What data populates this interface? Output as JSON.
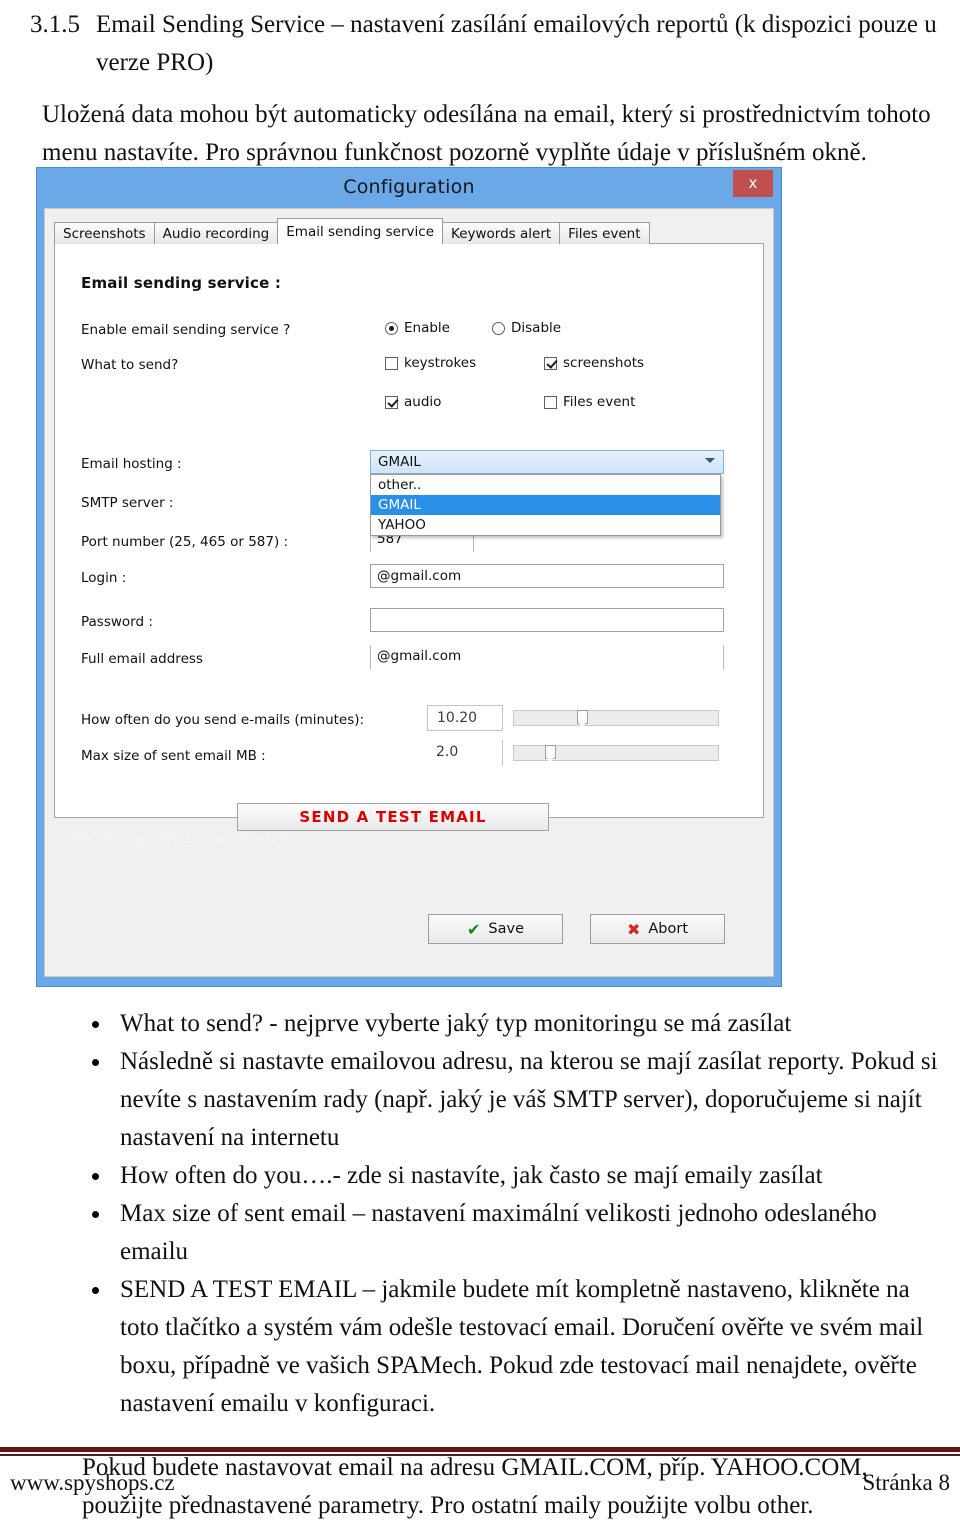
{
  "document": {
    "heading_number": "3.1.5",
    "heading_text": "Email Sending Service – nastavení zasílání emailových reportů (k dispozici pouze u verze PRO)",
    "intro_paragraph": "Uložená data mohou být automaticky odesílána na email, který si prostřednictvím tohoto menu nastavíte. Pro správnou funkčnost pozorně vyplňte údaje v příslušném okně.",
    "bullets": [
      "What to send? - nejprve vyberte jaký typ monitoringu se má zasílat",
      "Následně si nastavte emailovou adresu, na kterou se mají zasílat reporty. Pokud si nevíte s nastavením rady (např. jaký je váš SMTP server), doporučujeme si najít nastavení na internetu",
      "How often do you….- zde si nastavíte, jak často se mají emaily zasílat",
      "Max size of sent email – nastavení maximální velikosti jednoho odeslaného emailu",
      "SEND A TEST EMAIL – jakmile budete mít kompletně nastaveno, klikněte na toto tlačítko a systém vám odešle testovací email. Doručení ověřte ve svém mail boxu, případně ve vašich SPAMech. Pokud zde testovací mail nenajdete, ověřte nastavení emailu v konfiguraci."
    ],
    "closing_paragraph": "Pokud budete nastavovat email na adresu GMAIL.COM, příp. YAHOO.COM, použijte přednastavené parametry. Pro ostatní maily použijte volbu other.",
    "footer": {
      "left": "www.spyshops.cz",
      "right": "Stránka 8",
      "rule_color": "#5b1a13"
    }
  },
  "dialog": {
    "title": "Configuration",
    "close_label": "x",
    "titlebar_color": "#6aa8e8",
    "close_color": "#c0504d",
    "tabs": [
      {
        "label": "Screenshots",
        "active": false
      },
      {
        "label": "Audio recording",
        "active": false
      },
      {
        "label": "Email sending service",
        "active": true
      },
      {
        "label": "Keywords alert",
        "active": false
      },
      {
        "label": "Files event",
        "active": false
      }
    ],
    "section_title": "Email sending service :",
    "enable_row": {
      "label": "Enable email sending service ?",
      "option_enable": "Enable",
      "option_disable": "Disable",
      "selected": "Enable"
    },
    "what_to_send": {
      "label": "What to send?",
      "options": [
        {
          "label": "keystrokes",
          "checked": false
        },
        {
          "label": "screenshots",
          "checked": true
        },
        {
          "label": "audio",
          "checked": true
        },
        {
          "label": "Files event",
          "checked": false
        }
      ]
    },
    "email_hosting": {
      "label": "Email hosting :",
      "value": "GMAIL",
      "options": [
        "other..",
        "GMAIL",
        "YAHOO"
      ],
      "selected_option": "GMAIL",
      "expanded": true
    },
    "smtp_server": {
      "label": "SMTP server :",
      "value": ""
    },
    "port_number": {
      "label": "Port number (25, 465 or 587) :",
      "value": "587"
    },
    "login": {
      "label": "Login :",
      "value": "@gmail.com"
    },
    "password": {
      "label": "Password :",
      "value": ""
    },
    "full_email": {
      "label": "Full email address",
      "value": "@gmail.com"
    },
    "how_often": {
      "label": "How often do you send e-mails (minutes):",
      "value": "10.20",
      "slider_percent": 33
    },
    "max_size": {
      "label": "Max size of sent email  MB :",
      "value": "2.0",
      "slider_percent": 17
    },
    "test_button": {
      "label": "SEND A TEST EMAIL",
      "color": "#d90000"
    },
    "status_text": "Monitoring software is activated",
    "save_button": {
      "label": "Save",
      "icon": "check"
    },
    "abort_button": {
      "label": "Abort",
      "icon": "cross"
    }
  }
}
